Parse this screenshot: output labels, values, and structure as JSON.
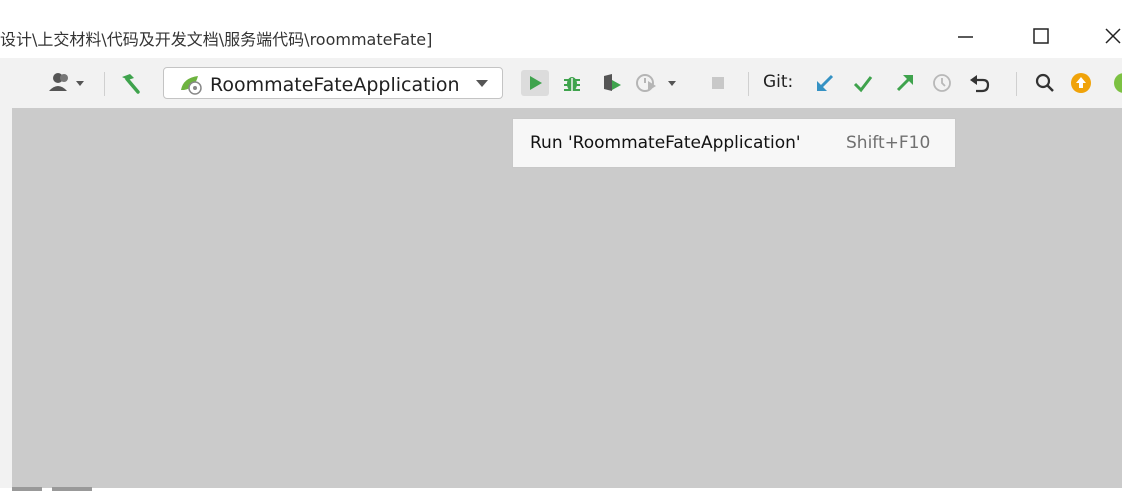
{
  "window": {
    "title": "设计\\上交材料\\代码及开发文档\\服务端代码\\roommateFate]"
  },
  "toolbar": {
    "run_config": "RoommateFateApplication",
    "git_label": "Git:",
    "icons": [
      "user-icon",
      "hammer-icon",
      "spring-app-icon",
      "run-icon",
      "debug-icon",
      "coverage-icon",
      "profile-icon",
      "stop-icon",
      "git-update-icon",
      "git-commit-icon",
      "git-push-icon",
      "history-icon",
      "rollback-icon",
      "search-icon",
      "update-icon"
    ]
  },
  "tooltip": {
    "text": "Run 'RoommateFateApplication'",
    "shortcut": "Shift+F10"
  },
  "colors": {
    "run_green": "#3fa34d",
    "git_blue": "#3592c4",
    "update_orange": "#f0a30a",
    "content_bg": "#cbcbcb"
  }
}
